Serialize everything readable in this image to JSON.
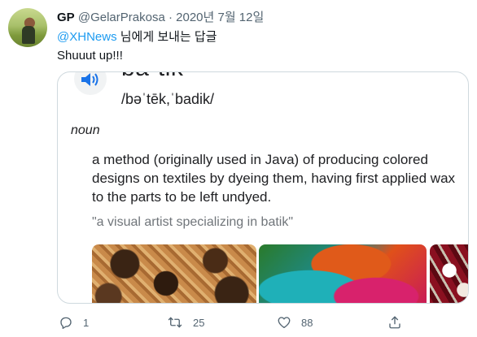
{
  "tweet": {
    "author_name": "GP",
    "author_handle": "@GelarPrakosa",
    "separator": "·",
    "date": "2020년 7월 12일",
    "reply_to_handle": "@XHNews",
    "reply_suffix": " 님에게 보내는 답글",
    "text": "Shuuut up!!!"
  },
  "card": {
    "word": "ba·tik",
    "phonetic": "/bəˈtēk,ˈbadik/",
    "part_of_speech": "noun",
    "definition": "a method (originally used in Java) of producing colored designs on textiles by dyeing them, having first applied wax to the parts to be left undyed.",
    "example": "\"a visual artist specializing in batik\""
  },
  "actions": {
    "reply_count": "1",
    "retweet_count": "25",
    "like_count": "88"
  },
  "colors": {
    "accent": "#1d9bf0",
    "muted": "#536471",
    "card_border": "#cfd9de"
  },
  "icons": [
    "speaker-icon",
    "reply-icon",
    "retweet-icon",
    "like-icon",
    "share-icon"
  ]
}
